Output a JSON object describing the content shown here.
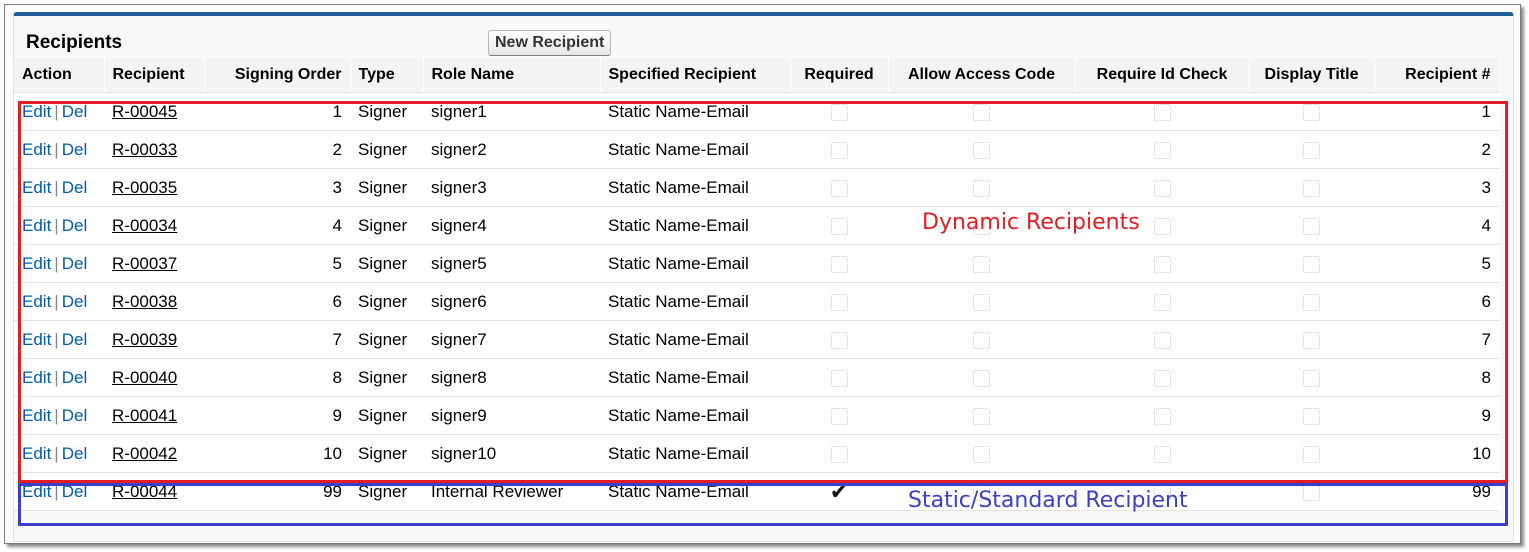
{
  "section": {
    "title": "Recipients",
    "new_button": "New Recipient"
  },
  "table": {
    "headers": {
      "action": "Action",
      "recipient": "Recipient",
      "signing_order": "Signing Order",
      "type": "Type",
      "role_name": "Role Name",
      "specified_recipient": "Specified Recipient",
      "required": "Required",
      "allow_access_code": "Allow Access Code",
      "require_id_check": "Require Id Check",
      "display_title": "Display Title",
      "recipient_num": "Recipient #"
    },
    "action_edit": "Edit",
    "action_sep": "|",
    "action_del": "Del",
    "rows": [
      {
        "recipient": "R-00045",
        "order": "1",
        "type": "Signer",
        "role": "signer1",
        "specified": "Static Name-Email",
        "required": false,
        "access_code": false,
        "id_check": false,
        "display_title": false,
        "num": "1"
      },
      {
        "recipient": "R-00033",
        "order": "2",
        "type": "Signer",
        "role": "signer2",
        "specified": "Static Name-Email",
        "required": false,
        "access_code": false,
        "id_check": false,
        "display_title": false,
        "num": "2"
      },
      {
        "recipient": "R-00035",
        "order": "3",
        "type": "Signer",
        "role": "signer3",
        "specified": "Static Name-Email",
        "required": false,
        "access_code": false,
        "id_check": false,
        "display_title": false,
        "num": "3"
      },
      {
        "recipient": "R-00034",
        "order": "4",
        "type": "Signer",
        "role": "signer4",
        "specified": "Static Name-Email",
        "required": false,
        "access_code": false,
        "id_check": false,
        "display_title": false,
        "num": "4"
      },
      {
        "recipient": "R-00037",
        "order": "5",
        "type": "Signer",
        "role": "signer5",
        "specified": "Static Name-Email",
        "required": false,
        "access_code": false,
        "id_check": false,
        "display_title": false,
        "num": "5"
      },
      {
        "recipient": "R-00038",
        "order": "6",
        "type": "Signer",
        "role": "signer6",
        "specified": "Static Name-Email",
        "required": false,
        "access_code": false,
        "id_check": false,
        "display_title": false,
        "num": "6"
      },
      {
        "recipient": "R-00039",
        "order": "7",
        "type": "Signer",
        "role": "signer7",
        "specified": "Static Name-Email",
        "required": false,
        "access_code": false,
        "id_check": false,
        "display_title": false,
        "num": "7"
      },
      {
        "recipient": "R-00040",
        "order": "8",
        "type": "Signer",
        "role": "signer8",
        "specified": "Static Name-Email",
        "required": false,
        "access_code": false,
        "id_check": false,
        "display_title": false,
        "num": "8"
      },
      {
        "recipient": "R-00041",
        "order": "9",
        "type": "Signer",
        "role": "signer9",
        "specified": "Static Name-Email",
        "required": false,
        "access_code": false,
        "id_check": false,
        "display_title": false,
        "num": "9"
      },
      {
        "recipient": "R-00042",
        "order": "10",
        "type": "Signer",
        "role": "signer10",
        "specified": "Static Name-Email",
        "required": false,
        "access_code": false,
        "id_check": false,
        "display_title": false,
        "num": "10"
      },
      {
        "recipient": "R-00044",
        "order": "99",
        "type": "Signer",
        "role": "Internal Reviewer",
        "specified": "Static Name-Email",
        "required": true,
        "access_code": false,
        "id_check": false,
        "display_title": false,
        "num": "99"
      }
    ]
  },
  "annotations": {
    "dynamic_label": "Dynamic Recipients",
    "static_label": "Static/Standard Recipient",
    "dynamic_color": "#e01e26",
    "static_color": "#3a3fc4"
  },
  "colors": {
    "link": "#015ba7",
    "header_bg": "#f2f3f3",
    "panel_accent": "#1f5f97"
  },
  "icons": {
    "checked": "check-mark-icon",
    "unchecked": "empty-checkbox-icon"
  }
}
